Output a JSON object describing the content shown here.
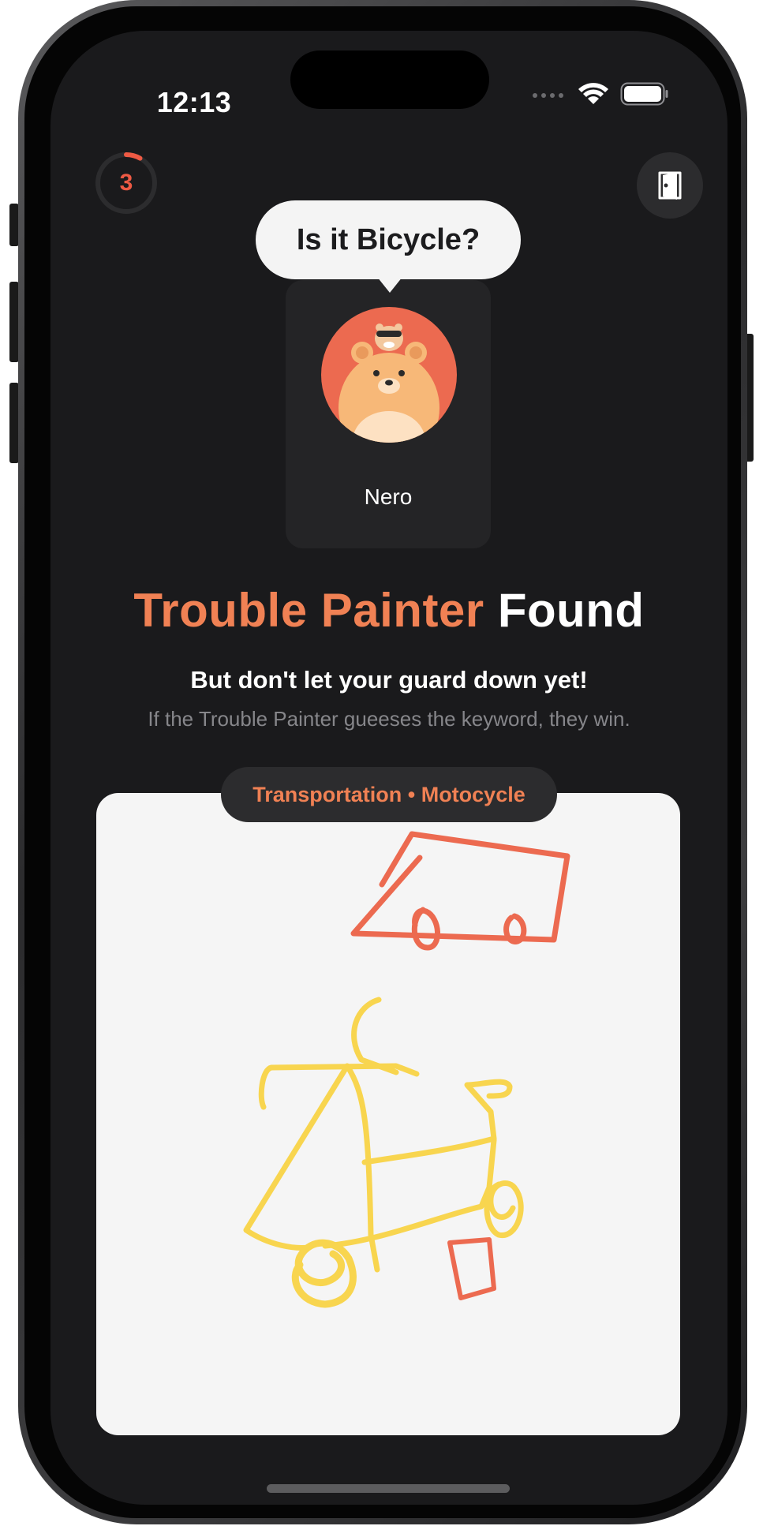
{
  "status_bar": {
    "time": "12:13"
  },
  "timer": {
    "value": "3",
    "progress_fraction": 0.08,
    "color": "#ee5a44"
  },
  "exit_button": {
    "icon": "door-exit-icon"
  },
  "player": {
    "guess_bubble": "Is it Bicycle?",
    "name": "Nero",
    "avatar": "bear-avatar"
  },
  "headline": {
    "accent": "Trouble Painter",
    "plain": "Found"
  },
  "subhead": "But don't let your guard down yet!",
  "subtext": "If the Trouble Painter gueeses the keyword, they win.",
  "category": {
    "label": "Transportation • Motocycle"
  },
  "colors": {
    "accent": "#f08154",
    "background": "#1a1a1c",
    "canvas": "#f5f5f5",
    "stroke_red": "#ec6a50",
    "stroke_yellow": "#f8d54f"
  }
}
